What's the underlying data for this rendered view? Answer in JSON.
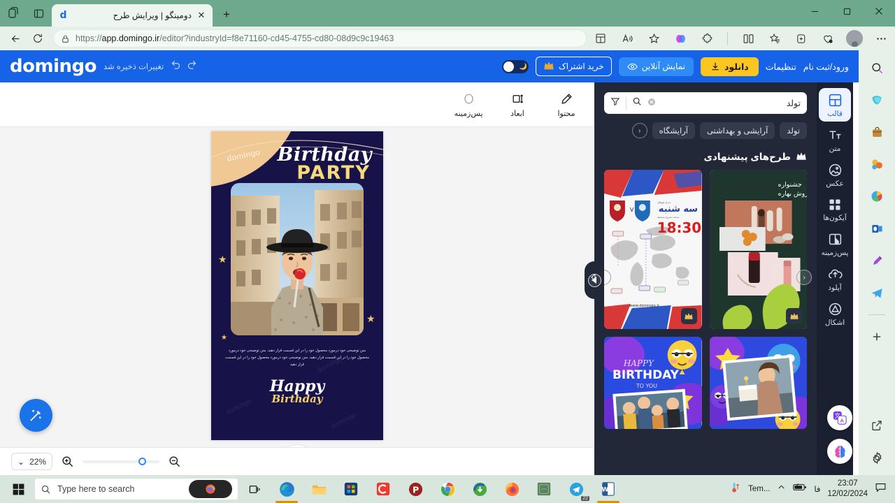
{
  "browser": {
    "tab": {
      "title": "دومینگو | ویرایش طرح",
      "favicon_letter": "d"
    },
    "new_tab_label": "+",
    "url_scheme": "https://",
    "url_domain": "app.domingo.ir",
    "url_path": "/editor?industryId=f8e71160-cd45-4755-cd80-08d9c9c19463",
    "window": {
      "minimize": "—",
      "maximize": "❐",
      "close": "✕"
    }
  },
  "app_header": {
    "logo": "domingo",
    "saved_text": "تغییرات ذخیره شد",
    "login_link": "ورود/ثبت نام",
    "settings_link": "تنظیمات",
    "download_button": "دانلود",
    "preview_button": "نمایش آنلاین",
    "subscribe_button": "خرید اشتراک",
    "crown": "♛"
  },
  "toolbar": {
    "items": [
      {
        "label": "محتوا",
        "icon": "pencil-edit-icon"
      },
      {
        "label": "ابعاد",
        "icon": "resize-icon"
      },
      {
        "label": "پس‌زمینه",
        "icon": "circle-icon"
      }
    ]
  },
  "canvas": {
    "design": {
      "watermark": "domingo",
      "title_line1": "Birthday",
      "title_line2": "PARTY",
      "body_text": "متن توضیحی خود درمورد محصول خود را در این قسمت قرار دهید. متن توضیحی خود درمورد محصول خود را در این قسمت قرار دهید. متن توضیحی خود درمورد محصول خود را در این قسمت قرار دهید",
      "footer_line1": "Happy",
      "footer_line2": "Birthday"
    },
    "magic_button_icon": "magic-wand-icon",
    "expand_handle_icon": "chevron-up-icon"
  },
  "zoom_bar": {
    "zoom_value": "22%",
    "chevron": "⌄",
    "zoom_in_icon": "zoom-in-icon",
    "zoom_out_icon": "zoom-out-icon"
  },
  "side_panel": {
    "search": {
      "value": "تولد",
      "clear_icon": "clear-icon",
      "search_icon": "search-icon",
      "filter_icon": "filter-icon"
    },
    "chips": [
      "تولد",
      "آرایشی و بهداشتی",
      "آرایشگاه"
    ],
    "chip_nav_prev": "‹",
    "section_title": "طرح‌های پیشنهادی",
    "section_crown": "♛",
    "templates": [
      {
        "name": "football-match-template",
        "crown": "♛",
        "text_day": "سه شنبه",
        "text_time": "18:30",
        "text_site": "www.domingo.ir"
      },
      {
        "name": "cosmetics-sale-template",
        "crown": "♛",
        "text_line1": "جشنواره",
        "text_line2": "فروش بهاره"
      },
      {
        "name": "happy-birthday-template",
        "text_line1": "HAPPY",
        "text_line2": "BIRTHDAY",
        "text_line3": "TO YOU"
      },
      {
        "name": "birthday-photo-template",
        "text_line1": ""
      }
    ],
    "carousel_prev": "‹",
    "carousel_next": "›",
    "collapse_icon": "chevron-left-icon"
  },
  "rail": {
    "items": [
      {
        "label": "قالب",
        "icon": "template-grid-icon",
        "active": true
      },
      {
        "label": "متن",
        "icon": "text-icon",
        "active": false
      },
      {
        "label": "عکس",
        "icon": "image-icon",
        "active": false
      },
      {
        "label": "آیکون‌ها",
        "icon": "icons-grid-icon",
        "active": false
      },
      {
        "label": "پس‌زمینه",
        "icon": "background-icon",
        "active": false
      },
      {
        "label": "آپلود",
        "icon": "upload-cloud-icon",
        "active": false
      },
      {
        "label": "اشکال",
        "icon": "shapes-icon",
        "active": false
      }
    ],
    "floating": [
      {
        "name": "translate-icon"
      },
      {
        "name": "ai-brain-icon"
      }
    ]
  },
  "taskbar": {
    "search_placeholder": "Type here to search",
    "temp_label": "Tem...",
    "time": "23:07",
    "date": "12/02/2024",
    "lang": "فا",
    "telegram_badge": "22"
  }
}
